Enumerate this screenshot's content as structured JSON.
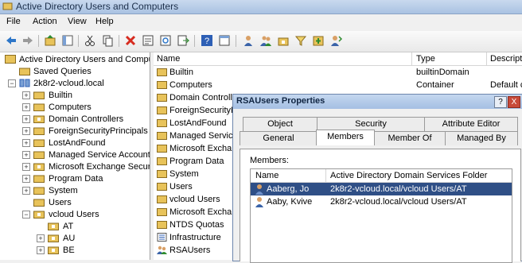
{
  "window": {
    "title": "Active Directory Users and Computers"
  },
  "menu": [
    "File",
    "Action",
    "View",
    "Help"
  ],
  "toolbar": {
    "icons": [
      "back-icon",
      "forward-icon",
      "up-icon",
      "show-hide-tree-icon",
      "cut-icon",
      "copy-icon",
      "delete-icon",
      "properties-icon",
      "refresh-icon",
      "export-icon",
      "help-icon",
      "console-icon",
      "users-icon",
      "groups-icon",
      "ou-icon",
      "filter-icon",
      "add-group-icon",
      "move-icon"
    ]
  },
  "tree": {
    "root": "Active Directory Users and Comput",
    "saved_queries": "Saved Queries",
    "domain": "2k8r2-vcloud.local",
    "children": [
      "Builtin",
      "Computers",
      "Domain Controllers",
      "ForeignSecurityPrincipals",
      "LostAndFound",
      "Managed Service Accounts",
      "Microsoft Exchange Securit",
      "Program Data",
      "System",
      "Users",
      "vcloud Users"
    ],
    "vcloud_children": [
      "AT",
      "AU",
      "BE"
    ]
  },
  "list": {
    "columns": {
      "name": "Name",
      "type": "Type",
      "desc": "Descripti"
    },
    "rows": [
      {
        "name": "Builtin",
        "type": "builtinDomain",
        "desc": ""
      },
      {
        "name": "Computers",
        "type": "Container",
        "desc": "Default c"
      },
      {
        "name": "Domain Controller",
        "type": "",
        "desc": ""
      },
      {
        "name": "ForeignSecurityPr",
        "type": "",
        "desc": ""
      },
      {
        "name": "LostAndFound",
        "type": "",
        "desc": ""
      },
      {
        "name": "Managed Service",
        "type": "",
        "desc": ""
      },
      {
        "name": "Microsoft Exchan",
        "type": "",
        "desc": ""
      },
      {
        "name": "Program Data",
        "type": "",
        "desc": ""
      },
      {
        "name": "System",
        "type": "",
        "desc": ""
      },
      {
        "name": "Users",
        "type": "",
        "desc": ""
      },
      {
        "name": "vcloud Users",
        "type": "",
        "desc": ""
      },
      {
        "name": "Microsoft Exchan",
        "type": "",
        "desc": ""
      },
      {
        "name": "NTDS Quotas",
        "type": "",
        "desc": ""
      },
      {
        "name": "Infrastructure",
        "type": "",
        "desc": ""
      },
      {
        "name": "RSAUsers",
        "type": "",
        "desc": ""
      }
    ]
  },
  "dialog": {
    "title": "RSAUsers Properties",
    "help_btn": "?",
    "close_btn": "X",
    "tabs_back": [
      "Object",
      "Security",
      "Attribute Editor"
    ],
    "tabs_front": [
      "General",
      "Members",
      "Member Of",
      "Managed By"
    ],
    "members_label": "Members:",
    "members_columns": {
      "name": "Name",
      "folder": "Active Directory Domain Services Folder"
    },
    "members": [
      {
        "name": "Aaberg, Jo",
        "folder": "2k8r2-vcloud.local/vcloud Users/AT"
      },
      {
        "name": "Aaby, Kvive",
        "folder": "2k8r2-vcloud.local/vcloud Users/AT"
      }
    ]
  },
  "colors": {
    "selection": "#2f4f86",
    "folder": "#e8c35a",
    "titlebar": "#b8cde8"
  }
}
